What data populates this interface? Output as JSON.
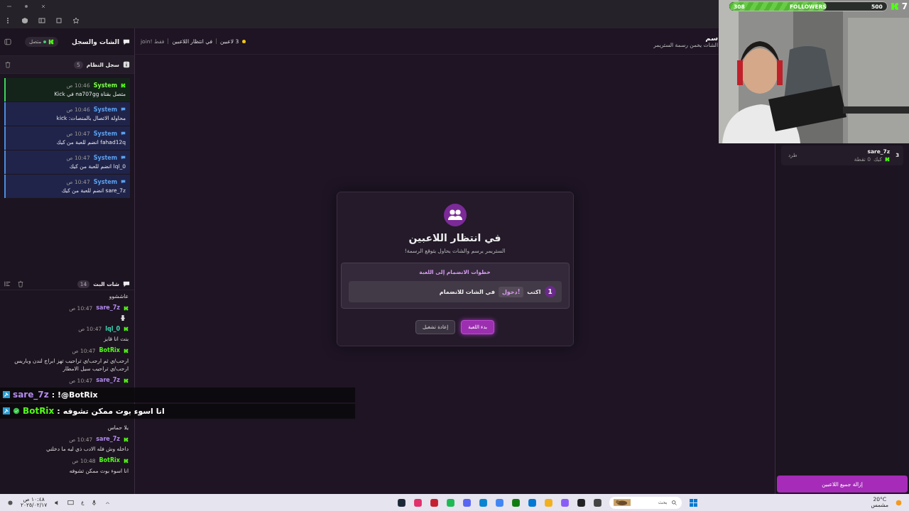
{
  "sidebar": {
    "title": "الشات والسجل",
    "status": {
      "label": "متصل",
      "connected": true
    },
    "system_log": {
      "title": "سجل النظام",
      "count": "5",
      "entries": [
        {
          "kind": "kick",
          "author": "System",
          "time": "10:46 ص",
          "text": "متصل بقناة na707gg في Kick"
        },
        {
          "kind": "system",
          "author": "System",
          "time": "10:46 ص",
          "text": "محاولة الاتصال بالمنصات: kick"
        },
        {
          "kind": "system",
          "author": "System",
          "time": "10:47 ص",
          "text": "fahad12q انضم للعبة من كيك"
        },
        {
          "kind": "system",
          "author": "System",
          "time": "10:47 ص",
          "text": "lql_0 انضم للعبة من كيك"
        },
        {
          "kind": "system",
          "author": "System",
          "time": "10:47 ص",
          "text": "sare_7z انضم للعبة من كيك"
        }
      ]
    },
    "chat": {
      "title": "شات البث",
      "count": "14",
      "messages": [
        {
          "kind": "text",
          "text": "عاششوو"
        },
        {
          "kind": "emote",
          "user": "sare_7z",
          "color": "#b48cf0",
          "time": "10:47 ص"
        },
        {
          "kind": "text",
          "user": "lql_0",
          "color": "#3fd6b4",
          "time": "10:47 ص",
          "text": "بنت انا قايز"
        },
        {
          "kind": "text",
          "user": "BotRix",
          "color": "#53fc18",
          "time": "10:47 ص",
          "text": "ارحب/ي ثم ارحب/ي تراحيب تهز ابراج لندن وباريس ارحب/ي تراحيب سيل الامطار"
        },
        {
          "kind": "covered",
          "user": "sare_7z",
          "color": "#b48cf0",
          "time": "10:47 ص"
        },
        {
          "kind": "text",
          "text": "يلا حماس"
        },
        {
          "kind": "text",
          "user": "sare_7z",
          "color": "#b48cf0",
          "time": "10:47 ص",
          "text": "داخله وش فله الادب ذي ليه ما دخلني"
        },
        {
          "kind": "text",
          "user": "BotRix",
          "color": "#53fc18",
          "time": "10:48 ص",
          "text": "انا اسوء بوت ممكن تشوفه"
        }
      ]
    }
  },
  "stream_overlay": [
    {
      "user": "sare_7z",
      "color": "#b48cf0",
      "separator": ":",
      "text": "!@BotRix",
      "verified": false
    },
    {
      "user": "BotRix",
      "color": "#53fc18",
      "separator": ":",
      "text": "انا اسوء بوت ممكن تشوفه",
      "verified": true
    }
  ],
  "topbar": {
    "players": "3 لاعبين",
    "state": "في انتظار اللاعبين",
    "hint": "فقط !join",
    "title": "سم",
    "subtitle": "الشات يخمن رسمة الستريمر"
  },
  "waiting_card": {
    "title": "في انتظار اللاعبين",
    "subtitle": "الستريمر يرسم والشات يحاول يتوقع الرسمة!",
    "steps_title": "خطوات الانضمام إلى اللعبة",
    "steps": [
      {
        "number": "1",
        "before": "اكتب",
        "command": "!دخول",
        "after": "في الشات للانضمام"
      }
    ],
    "buttons": [
      {
        "label": "بدء اللعبة",
        "kind": "primary"
      },
      {
        "label": "إعادة تشغيل",
        "kind": "secondary"
      }
    ]
  },
  "players": {
    "items": [
      {
        "rank": "3",
        "name": "sare_7z",
        "platform": "كيك",
        "points": "0 نقطة",
        "action": "طرد"
      }
    ],
    "clear_button": "إزالة جميع اللاعبين"
  },
  "webcam": {
    "followers": {
      "current": "308",
      "label": "FOLLOWERS",
      "goal": "500",
      "level": 0.616
    },
    "kick_count": "7"
  },
  "taskbar": {
    "time": "١٠:٤٨ ص",
    "date": "٢٠٢٥/٠٢/١٧",
    "language": "ع",
    "search": "بحث",
    "temperature": "20°C",
    "weather": "مشمس"
  }
}
